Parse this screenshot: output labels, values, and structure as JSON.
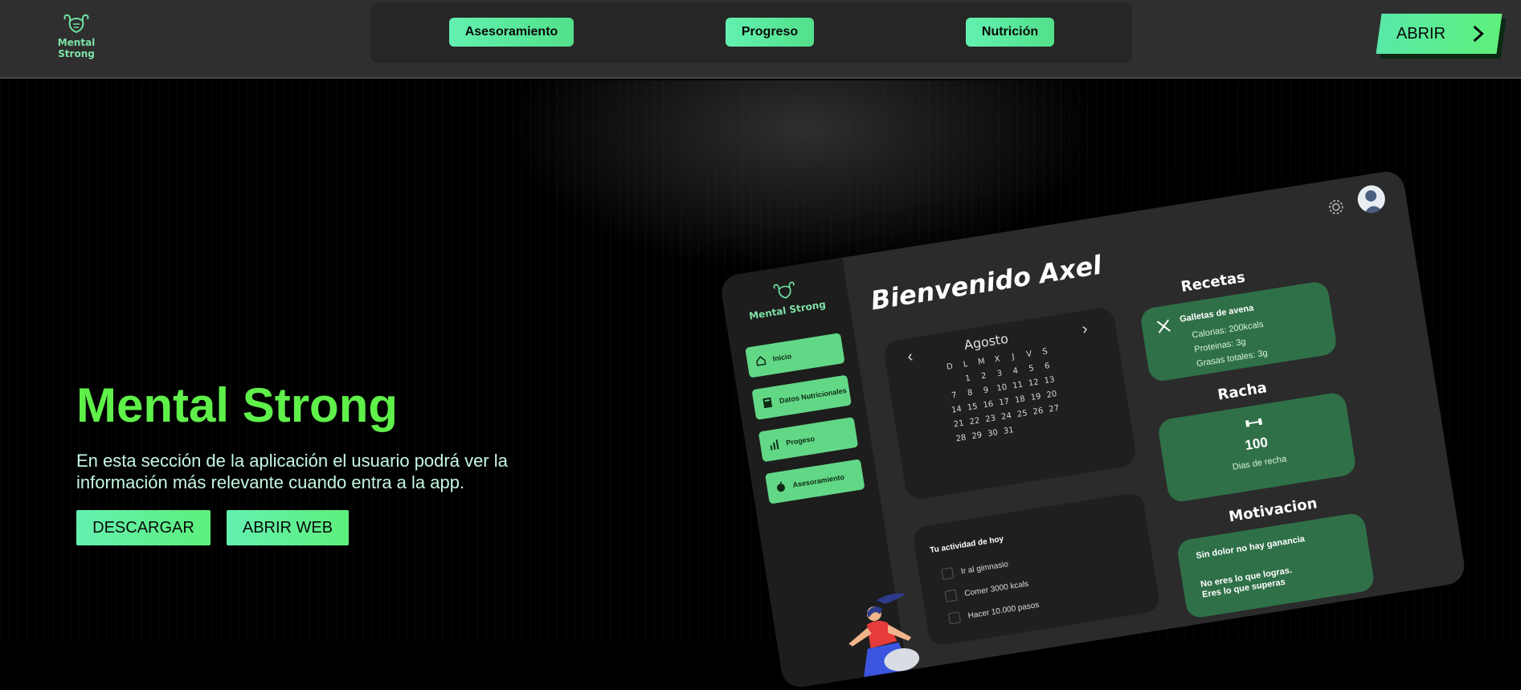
{
  "header": {
    "logo_text": "Mental Strong",
    "nav": [
      "Asesoramiento",
      "Progreso",
      "Nutrición"
    ],
    "open_label": "ABRIR"
  },
  "hero": {
    "title": "Mental Strong",
    "description": "En esta sección de la aplicación el usuario podrá ver la información más relevante cuando entra a la app.",
    "download_label": "DESCARGAR",
    "web_label": "ABRIR WEB"
  },
  "mockup": {
    "logo_text": "Mental Strong",
    "welcome": "Bienvenido Axel",
    "sidebar": [
      "Inicio",
      "Datos Nutricionales",
      "Progeso",
      "Asesoramiento"
    ],
    "calendar": {
      "month": "Agosto",
      "weekdays": [
        "D",
        "L",
        "M",
        "X",
        "J",
        "V",
        "S"
      ],
      "days": [
        "",
        "1",
        "2",
        "3",
        "4",
        "5",
        "6",
        "7",
        "8",
        "9",
        "10",
        "11",
        "12",
        "13",
        "14",
        "15",
        "16",
        "17",
        "18",
        "19",
        "20",
        "21",
        "22",
        "23",
        "24",
        "25",
        "26",
        "27",
        "28",
        "29",
        "30",
        "31"
      ]
    },
    "activity": {
      "title": "Tu actividad de hoy",
      "items": [
        "Ir al gimnasio",
        "Comer 3000 kcals",
        "Hacer 10.000 pasos"
      ]
    },
    "recipes": {
      "title": "Recetas",
      "name": "Galletas de avena",
      "calories": "Calorias: 200kcals",
      "protein": "Proteinas: 3g",
      "fat": "Grasas totales: 3g"
    },
    "streak": {
      "title": "Racha",
      "value": "100",
      "label": "Dias de recha"
    },
    "motivation": {
      "title": "Motivacion",
      "line1": "Sin dolor no hay ganancia",
      "line2": "No eres lo que logras. Eres lo que superas"
    }
  },
  "colors": {
    "accent": "#5ff04a",
    "button": "#5ef07c",
    "card": "#2f7048"
  }
}
